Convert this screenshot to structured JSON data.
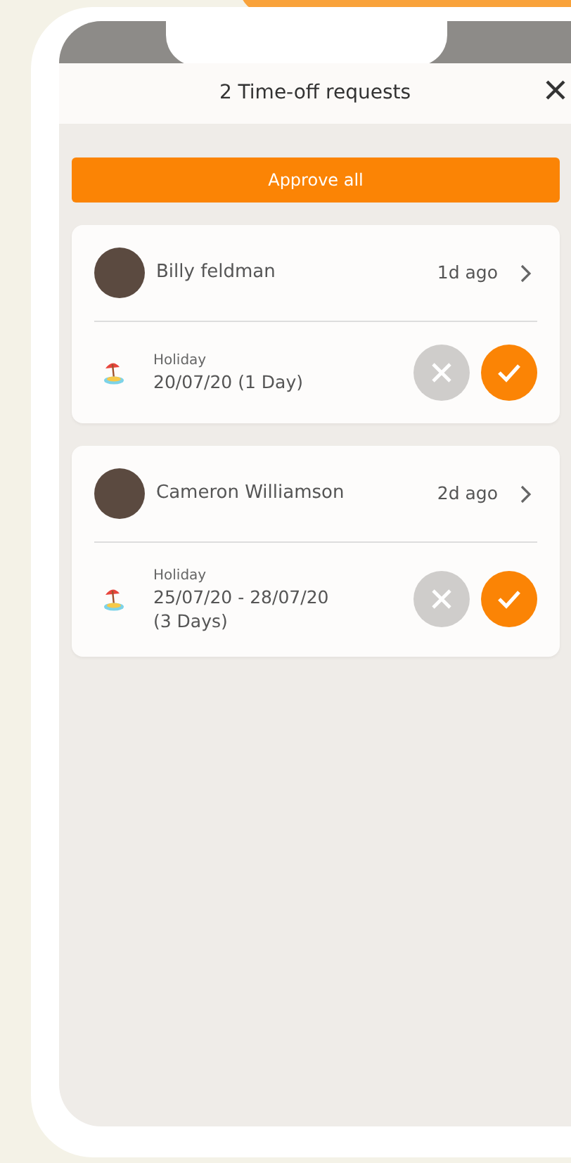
{
  "header": {
    "title": "2 Time-off requests"
  },
  "approve_all": {
    "label": "Approve all"
  },
  "requests": [
    {
      "name": "Billy feldman",
      "time": "1d ago",
      "type": "Holiday",
      "dates": [
        "20/07/20 (1 Day)"
      ]
    },
    {
      "name": "Cameron Williamson",
      "time": "2d ago",
      "type": "Holiday",
      "dates": [
        "25/07/20 - 28/07/20",
        "(3 Days)"
      ]
    }
  ]
}
